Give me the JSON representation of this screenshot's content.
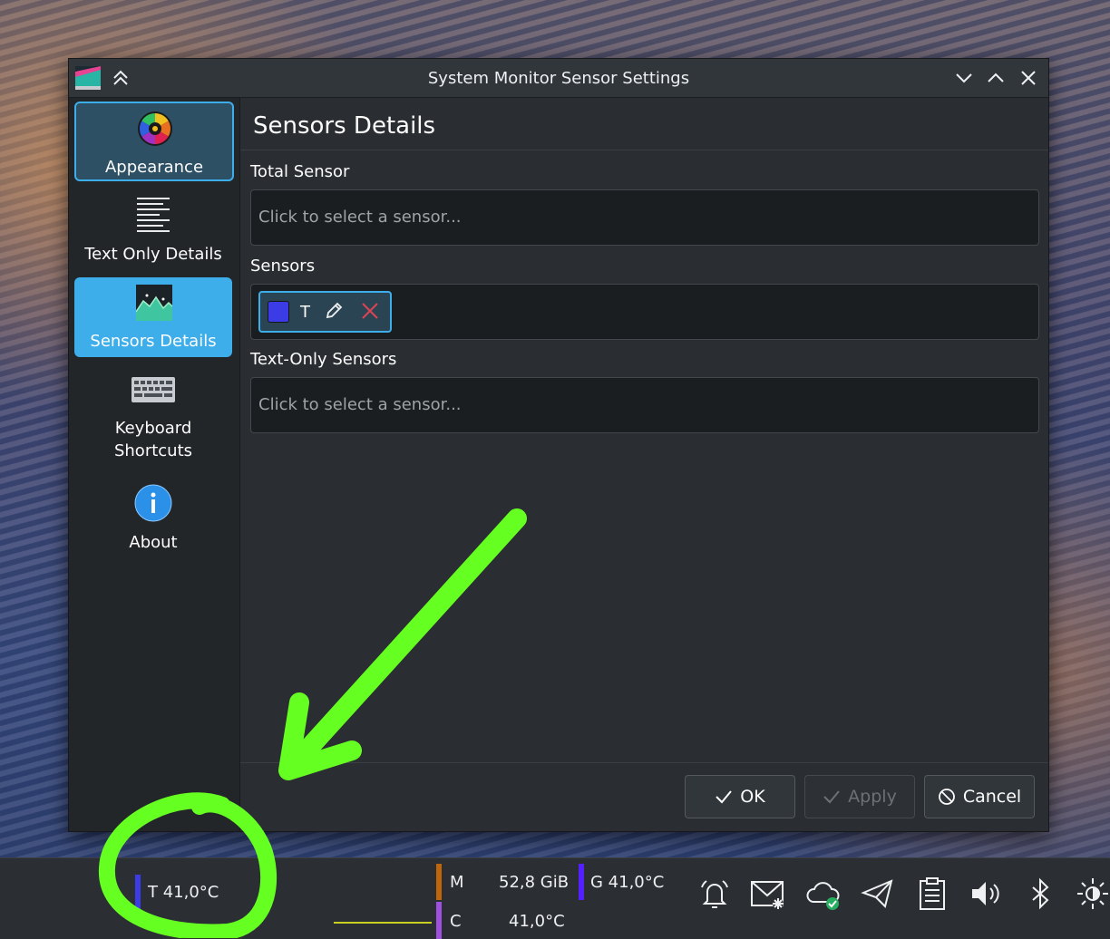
{
  "window": {
    "title": "System Monitor Sensor Settings"
  },
  "sidebar": {
    "items": [
      {
        "label": "Appearance",
        "icon": "color-wheel-icon"
      },
      {
        "label": "Text Only Details",
        "icon": "text-lines-icon"
      },
      {
        "label": "Sensors Details",
        "icon": "area-graph-icon"
      },
      {
        "label_line1": "Keyboard",
        "label_line2": "Shortcuts",
        "icon": "keyboard-icon"
      },
      {
        "label": "About",
        "icon": "info-icon"
      }
    ]
  },
  "main": {
    "page_title": "Sensors Details",
    "total_sensor": {
      "label": "Total Sensor",
      "placeholder": "Click to select a sensor..."
    },
    "sensors": {
      "label": "Sensors",
      "chips": [
        {
          "name": "T",
          "color": "#3c3ce6"
        }
      ]
    },
    "text_only_sensors": {
      "label": "Text-Only Sensors",
      "placeholder": "Click to select a sensor..."
    }
  },
  "buttons": {
    "ok": "OK",
    "apply": "Apply",
    "cancel": "Cancel"
  },
  "taskbar": {
    "widget_temp": "T 41,0°C",
    "mem_label": "M",
    "mem_value": "52,8 GiB",
    "gpu_temp": "G 41,0°C",
    "cpu_label": "C",
    "cpu_value": "41,0°C",
    "colors": {
      "temp": "#3c3ce6",
      "mem": "#c0660a",
      "gpu": "#5520ff",
      "cpu": "#a050e0"
    }
  },
  "accent_color": "#3daee9",
  "annotation_color": "#66ff22"
}
